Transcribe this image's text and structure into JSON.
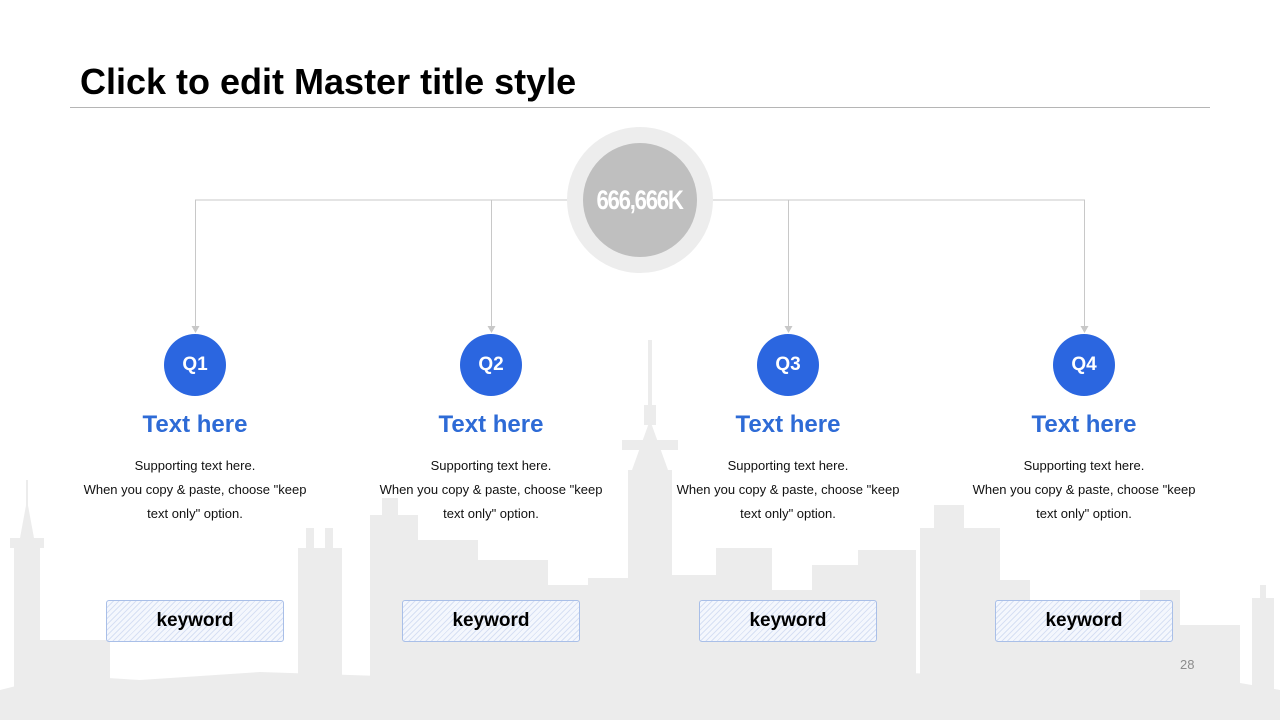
{
  "slide": {
    "title": "Click to edit Master title style",
    "page_number": "28"
  },
  "hub": {
    "value": "666,666K"
  },
  "quarters": [
    {
      "badge": "Q1",
      "heading": "Text here",
      "body_lines": [
        "Supporting text here.",
        "When you copy & paste, choose \"keep",
        "text only\" option."
      ],
      "keyword": "keyword"
    },
    {
      "badge": "Q2",
      "heading": "Text here",
      "body_lines": [
        "Supporting text here.",
        "When you copy & paste, choose \"keep",
        "text only\" option."
      ],
      "keyword": "keyword"
    },
    {
      "badge": "Q3",
      "heading": "Text here",
      "body_lines": [
        "Supporting text here.",
        "When you copy & paste, choose \"keep",
        "text only\" option."
      ],
      "keyword": "keyword"
    },
    {
      "badge": "Q4",
      "heading": "Text here",
      "body_lines": [
        "Supporting text here.",
        "When you copy & paste, choose \"keep",
        "text only\" option."
      ],
      "keyword": "keyword"
    }
  ],
  "colors": {
    "accent": "#2b66e0",
    "heading": "#2e6bd6",
    "hub_inner": "#bfbfbf",
    "hub_outer": "#ededed",
    "skyline": "#ececec"
  }
}
